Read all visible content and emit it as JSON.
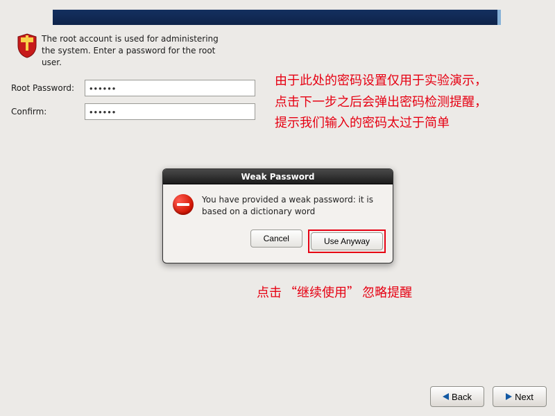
{
  "intro_text": "The root account is used for administering the system.  Enter a password for the root user.",
  "fields": {
    "root_label": "Root Password:",
    "root_value": "••••••",
    "confirm_label": "Confirm:",
    "confirm_value": "••••••"
  },
  "annotation1_line1": "由于此处的密码设置仅用于实验演示，",
  "annotation1_line2": "点击下一步之后会弹出密码检测提醒，",
  "annotation1_line3": "提示我们输入的密码太过于简单",
  "annotation2": "点击 “继续使用” 忽略提醒",
  "dialog": {
    "title": "Weak Password",
    "message": "You have provided a weak password: it is based on a dictionary word",
    "cancel_label": "Cancel",
    "use_anyway_label": "Use Anyway"
  },
  "nav": {
    "back_label": "Back",
    "next_label": "Next"
  }
}
